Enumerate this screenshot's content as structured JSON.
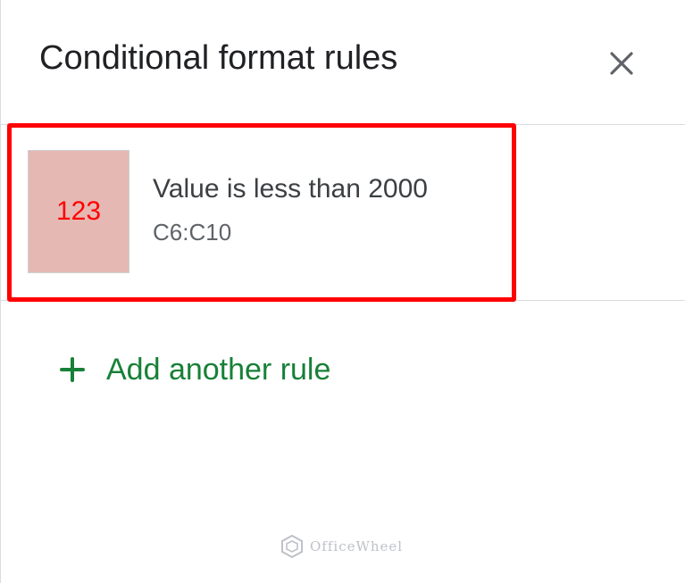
{
  "panel": {
    "title": "Conditional format rules",
    "close_icon": "close-icon"
  },
  "rule": {
    "preview_text": "123",
    "preview_bg": "#e6b8b3",
    "preview_text_color": "#ff0000",
    "condition": "Value is less than 2000",
    "range": "C6:C10",
    "highlight_color": "#ff0000"
  },
  "add_rule": {
    "icon": "plus-icon",
    "label": "Add another rule",
    "color": "#188038"
  },
  "watermark": {
    "text": "OfficeWheel"
  }
}
